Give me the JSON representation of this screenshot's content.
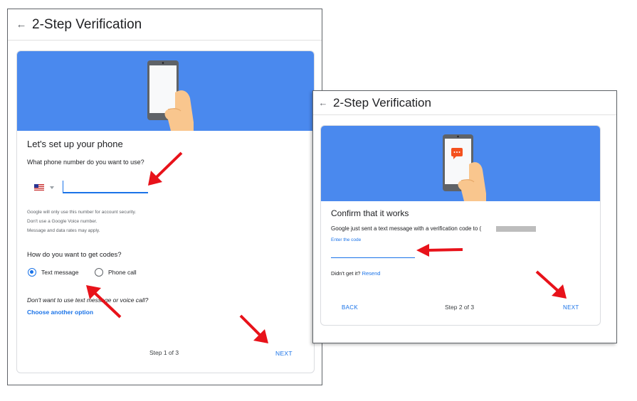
{
  "colors": {
    "accent": "#1a73e8",
    "banner": "#4a89ee",
    "annotation": "#e8121a",
    "text": "#202124"
  },
  "window1": {
    "back_icon": "arrow-back-icon",
    "back_glyph": "←",
    "title": "2-Step Verification",
    "heading": "Let's set up your phone",
    "phone_question": "What phone number do you want to use?",
    "country_icon": "us-flag-icon",
    "phone_value": "",
    "phone_placeholder": "",
    "notes": [
      "Google will only use this number for account security.",
      "Don't use a Google Voice number.",
      "Message and data rates may apply."
    ],
    "codes_question": "How do you want to get codes?",
    "options": [
      {
        "label": "Text message",
        "selected": true
      },
      {
        "label": "Phone call",
        "selected": false
      }
    ],
    "alt_prompt": "Don't want to use text message or voice call?",
    "alt_link": "Choose another option",
    "step": "Step 1 of 3",
    "next": "NEXT"
  },
  "window2": {
    "back_icon": "arrow-back-icon",
    "back_glyph": "←",
    "title": "2-Step Verification",
    "heading": "Confirm that it works",
    "sent_message": "Google just sent a text message with a verification code to (",
    "code_label": "Enter the code",
    "code_value": "",
    "didnt_get": "Didn't get it?",
    "resend": "Resend",
    "back": "BACK",
    "step": "Step 2 of 3",
    "next": "NEXT"
  }
}
